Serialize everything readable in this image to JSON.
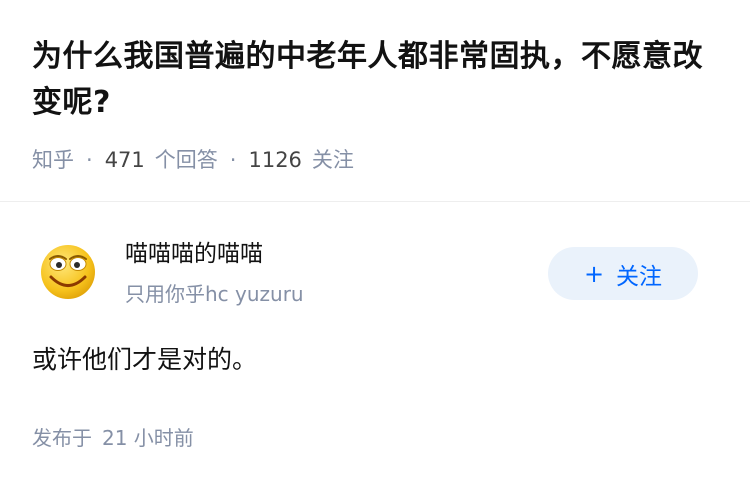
{
  "question": {
    "title": "为什么我国普遍的中老年人都非常固执，不愿意改变呢?"
  },
  "meta": {
    "source": "知乎",
    "separator": "·",
    "answers_count": "471",
    "answers_label": "个回答",
    "followers_count": "1126",
    "followers_label": "关注"
  },
  "author": {
    "avatar_icon": "smiley-face-icon",
    "name": "喵喵喵的喵喵",
    "bio": "只用你乎hc yuzuru"
  },
  "follow_button": {
    "plus": "+",
    "label": "关注",
    "text_color": "#0066ff",
    "background": "#eaf2fb"
  },
  "answer": {
    "content": "或许他们才是对的。",
    "published_label": "发布于",
    "published_time": "21 小时前"
  }
}
